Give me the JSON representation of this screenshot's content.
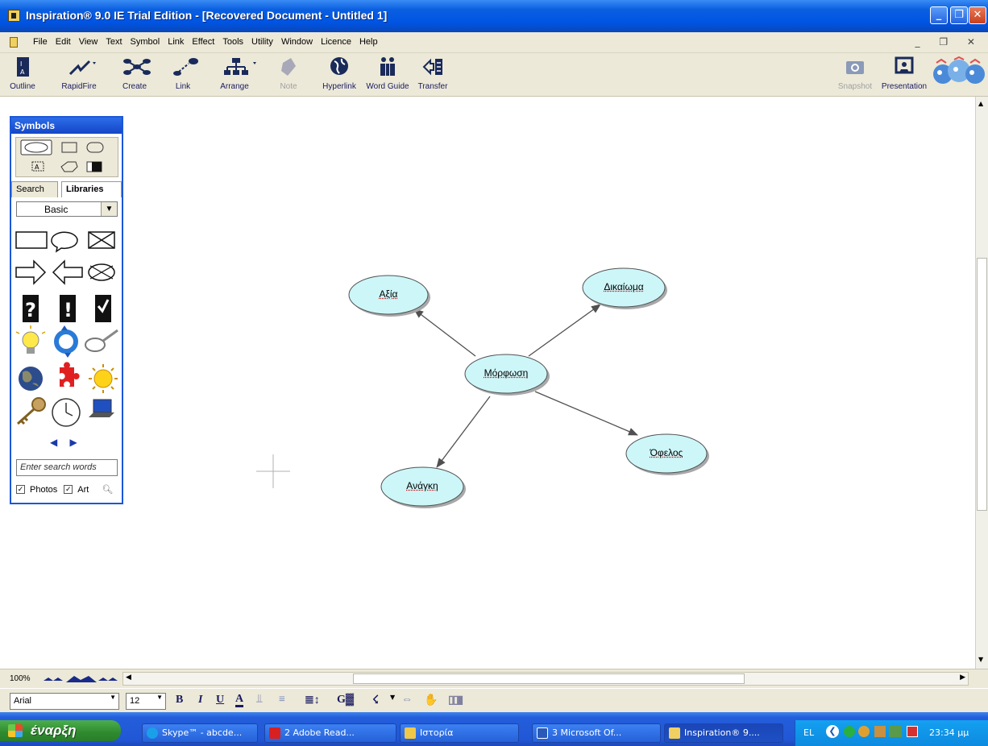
{
  "window": {
    "title": "Inspiration® 9.0 IE Trial Edition - [Recovered Document - Untitled 1]"
  },
  "menubar": {
    "items": [
      "File",
      "Edit",
      "View",
      "Text",
      "Symbol",
      "Link",
      "Effect",
      "Tools",
      "Utility",
      "Window",
      "Licence",
      "Help"
    ]
  },
  "toolbar": {
    "outline": "Outline",
    "rapidfire": "RapidFire",
    "create": "Create",
    "link": "Link",
    "arrange": "Arrange",
    "note": "Note",
    "hyperlink": "Hyperlink",
    "word_guide": "Word Guide",
    "transfer": "Transfer",
    "snapshot": "Snapshot",
    "presentation": "Presentation"
  },
  "symbols_palette": {
    "title": "Symbols",
    "tab_search": "Search",
    "tab_libraries": "Libraries",
    "library": "Basic",
    "search_placeholder": "Enter search words",
    "photos_label": "Photos",
    "art_label": "Art"
  },
  "diagram": {
    "nodes": {
      "center": "Μόρφωση",
      "top_left": "Αξία",
      "top_right": "Δικαίωμα",
      "bottom_right": "Όφελος",
      "bottom_left": "Ανάγκη"
    },
    "node_fill": "#cdf6f8"
  },
  "statusbar": {
    "zoom": "100%"
  },
  "formatbar": {
    "font": "Arial",
    "size": "12"
  },
  "taskbar": {
    "start": "έναρξη",
    "tasks": [
      "Skype™ - abcde...",
      "2 Adobe Read...",
      "Ιστορία",
      "3 Microsoft Of...",
      "Inspiration® 9...."
    ],
    "lang": "EL",
    "clock": "23:34 μμ"
  }
}
